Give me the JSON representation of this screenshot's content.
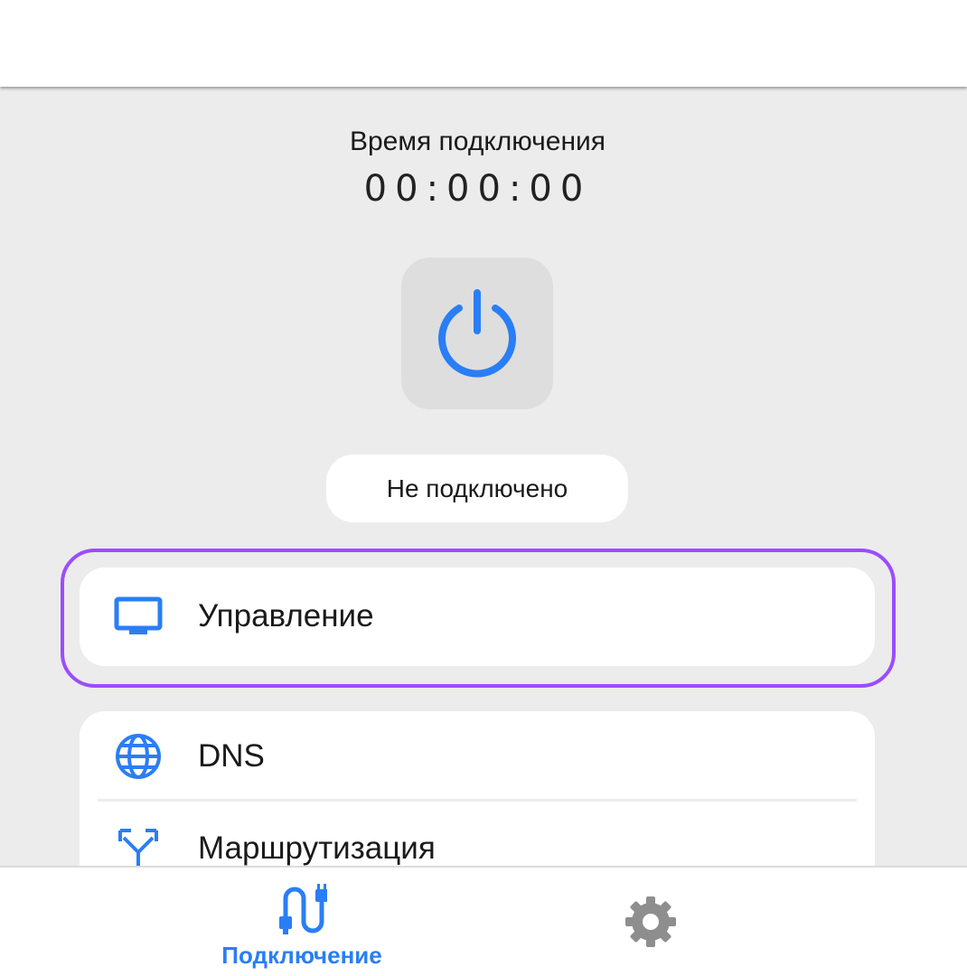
{
  "connection": {
    "time_label": "Время подключения",
    "time_value": "00:00:00",
    "status_text": "Не подключено"
  },
  "menu": {
    "items": [
      {
        "label": "Управление",
        "icon": "monitor-icon"
      },
      {
        "label": "DNS",
        "icon": "globe-icon"
      },
      {
        "label": "Маршрутизация",
        "icon": "route-split-icon"
      }
    ]
  },
  "bottom_nav": {
    "tabs": [
      {
        "label": "Подключение",
        "icon": "cable-icon",
        "active": true
      },
      {
        "label": "",
        "icon": "gear-icon",
        "active": false
      }
    ]
  },
  "colors": {
    "accent": "#2a7ef5",
    "focus": "#9b4dff",
    "background": "#ececec",
    "inactive_icon": "#8e8e8e"
  }
}
